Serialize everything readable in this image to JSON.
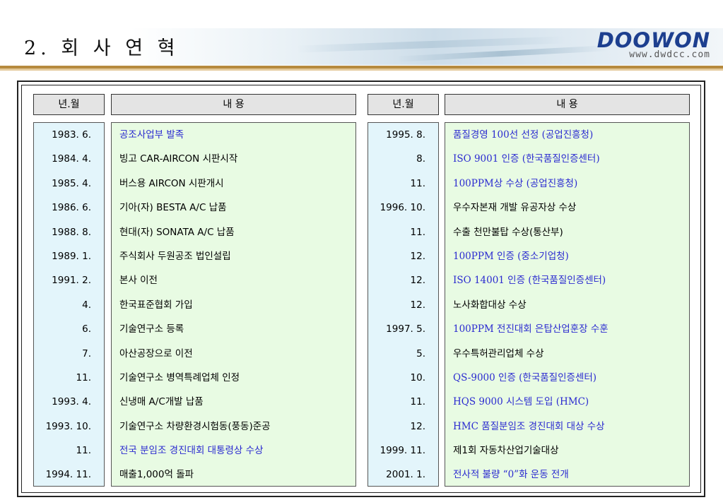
{
  "header": {
    "title": "2. 회 사 연 혁",
    "logo_name": "DOOWON",
    "logo_url": "www.dwdcc.com"
  },
  "table": {
    "col_date_label": "년.월",
    "col_content_label": "내       용",
    "left_dates": [
      "1983.  6.",
      "1984.  4.",
      "1985.  4.",
      "1986.  6.",
      "1988.  8.",
      "1989.  1.",
      "1991.  2.",
      "4.",
      "6.",
      "7.",
      "11.",
      "1993.  4.",
      "1993. 10.",
      "11.",
      "1994. 11."
    ],
    "left_events": [
      {
        "text": "공조사업부 발족",
        "highlight": true
      },
      {
        "text": "빙고 CAR-AIRCON 시판시작",
        "highlight": false
      },
      {
        "text": "버스용 AIRCON 시판개시",
        "highlight": false
      },
      {
        "text": "기아(자) BESTA A/C 납품",
        "highlight": false
      },
      {
        "text": "현대(자) SONATA A/C 납품",
        "highlight": false
      },
      {
        "text": "주식회사 두원공조 법인설립",
        "highlight": false
      },
      {
        "text": "본사 이전",
        "highlight": false
      },
      {
        "text": "한국표준협회 가입",
        "highlight": false
      },
      {
        "text": "기술연구소 등록",
        "highlight": false
      },
      {
        "text": "아산공장으로 이전",
        "highlight": false
      },
      {
        "text": "기술연구소 병역특례업체 인정",
        "highlight": false
      },
      {
        "text": "신냉매 A/C개발 납품",
        "highlight": false
      },
      {
        "text": "기술연구소 차량환경시험동(풍동)준공",
        "highlight": false
      },
      {
        "text": "전국 분임조 경진대회 대통령상 수상",
        "highlight": true
      },
      {
        "text": "매출1,000억 돌파",
        "highlight": false
      }
    ],
    "right_dates": [
      "1995.  8.",
      "8.",
      "11.",
      "1996. 10.",
      "11.",
      "12.",
      "12.",
      "12.",
      "1997.  5.",
      "5.",
      "10.",
      "11.",
      "12.",
      "1999. 11.",
      "2001.  1."
    ],
    "right_events": [
      {
        "text": "품질경영 100선 선정 (공업진흥청)",
        "highlight": true
      },
      {
        "text": "ISO 9001 인증 (한국품질인증센터)",
        "highlight": true
      },
      {
        "text": "100PPM상 수상 (공업진흥청)",
        "highlight": true
      },
      {
        "text": "우수자본재 개발 유공자상 수상",
        "highlight": false
      },
      {
        "text": "수출 천만불탑 수상(통산부)",
        "highlight": false
      },
      {
        "text": "100PPM 인증 (중소기업청)",
        "highlight": true
      },
      {
        "text": "ISO 14001 인증 (한국품질인증센터)",
        "highlight": true
      },
      {
        "text": "노사화합대상 수상",
        "highlight": false
      },
      {
        "text": "100PPM 전진대회 은탑산업훈장 수훈",
        "highlight": true
      },
      {
        "text": "우수특허관리업체 수상",
        "highlight": false
      },
      {
        "text": "QS-9000 인증 (한국품질인증센터)",
        "highlight": true
      },
      {
        "text": "HQS 9000 시스템 도입 (HMC)",
        "highlight": true
      },
      {
        "text": "HMC 품질분임조 경진대회 대상 수상",
        "highlight": true
      },
      {
        "text": "제1회 자동차산업기술대상",
        "highlight": false
      },
      {
        "text": "전사적 불량 “0”화 운동 전개",
        "highlight": true
      }
    ]
  },
  "colors": {
    "highlight_text": "#2a2ad0",
    "date_bg": "#e3f5fb",
    "event_bg": "#e8fbe3",
    "header_bg": "#e4e4e4",
    "rule_gold": "#b68a3e",
    "logo_blue": "#1d3f8f"
  }
}
